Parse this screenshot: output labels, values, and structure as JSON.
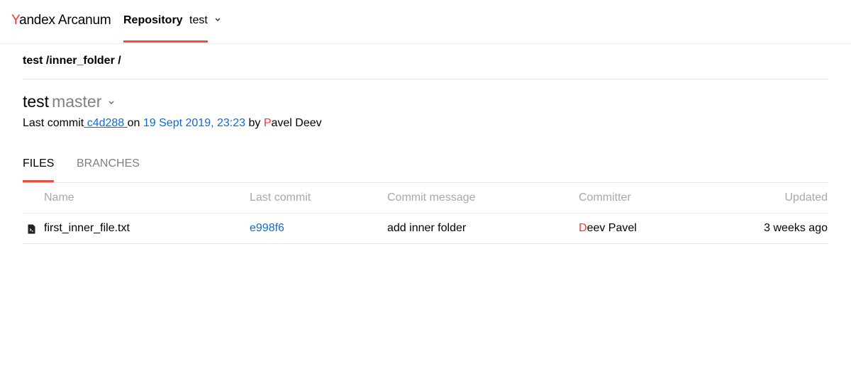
{
  "app": {
    "logo_yandex_first": "Y",
    "logo_yandex_rest": "andex",
    "logo_product": "Arcanum"
  },
  "header": {
    "nav_label": "Repository",
    "repo_name": "test"
  },
  "breadcrumb": "test /inner_folder /",
  "repo_title": {
    "name": "test",
    "branch": "master"
  },
  "last_commit": {
    "prefix": "Last commit",
    "hash": " c4d288 ",
    "on_label": "on",
    "date": "19 Sept 2019, 23:23",
    "by_label": "by",
    "author_initial": "P",
    "author_rest": "avel Deev"
  },
  "tabs": [
    {
      "label": "FILES",
      "active": true
    },
    {
      "label": "BRANCHES",
      "active": false
    }
  ],
  "table": {
    "columns": [
      "Name",
      "Last commit",
      "Commit message",
      "Committer",
      "Updated"
    ],
    "rows": [
      {
        "name": "first_inner_file.txt",
        "last_commit": "e998f6",
        "message": "add inner folder",
        "committer_initial": "D",
        "committer_rest": "eev Pavel",
        "updated": "3 weeks ago",
        "icon": "text-file-icon"
      }
    ]
  },
  "colors": {
    "accent_red": "#f04b3e",
    "link_blue": "#0a6cd9",
    "muted": "#a8a8a8"
  }
}
